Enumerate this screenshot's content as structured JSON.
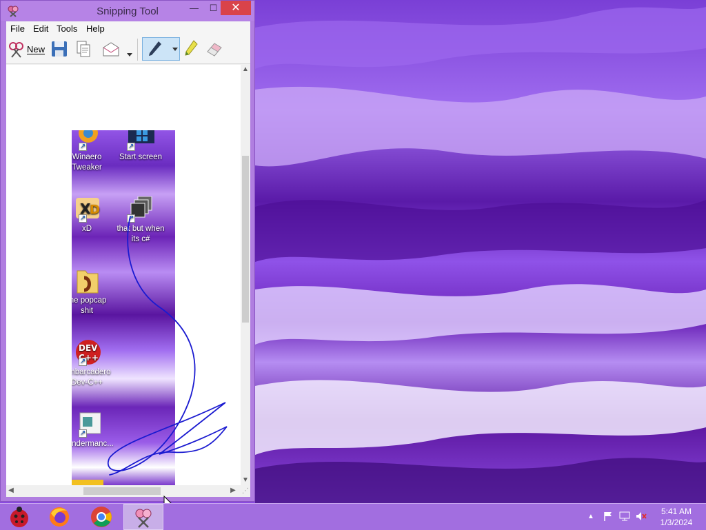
{
  "window": {
    "title": "Snipping Tool",
    "minimize": "—",
    "maximize": "☐",
    "close": "✕"
  },
  "menu": [
    "File",
    "Edit",
    "Tools",
    "Help"
  ],
  "toolbar": {
    "new_label": "New",
    "tools": [
      "scissors-icon",
      "save-icon",
      "copy-icon",
      "email-icon",
      "dropdown-arrow",
      "pen-icon",
      "highlighter-icon",
      "eraser-icon"
    ]
  },
  "snip_icons": [
    {
      "label1": "Winaero",
      "label2": "Tweaker"
    },
    {
      "label1": "Start screen",
      "label2": ""
    },
    {
      "label1": "xD",
      "label2": ""
    },
    {
      "label1": "that but when",
      "label2": "its c#"
    },
    {
      "label1": "the popcap",
      "label2": "shit"
    },
    {
      "label1": "Embarcadero",
      "label2": "Dev-C++"
    },
    {
      "label1": "Wondermanc...",
      "label2": ""
    }
  ],
  "dev_icon_text": {
    "line1": "DEV",
    "line2": "C++"
  },
  "taskbar": {
    "apps": [
      "ladybug-app",
      "firefox",
      "chrome",
      "snipping-tool"
    ],
    "clock_time": "5:41 AM",
    "clock_date": "1/3/2024"
  },
  "colors": {
    "window_frame": "#b07ee0",
    "close_button": "#d9434a",
    "taskbar": "#a26ee0",
    "pen_ink": "#1a1ad0"
  }
}
